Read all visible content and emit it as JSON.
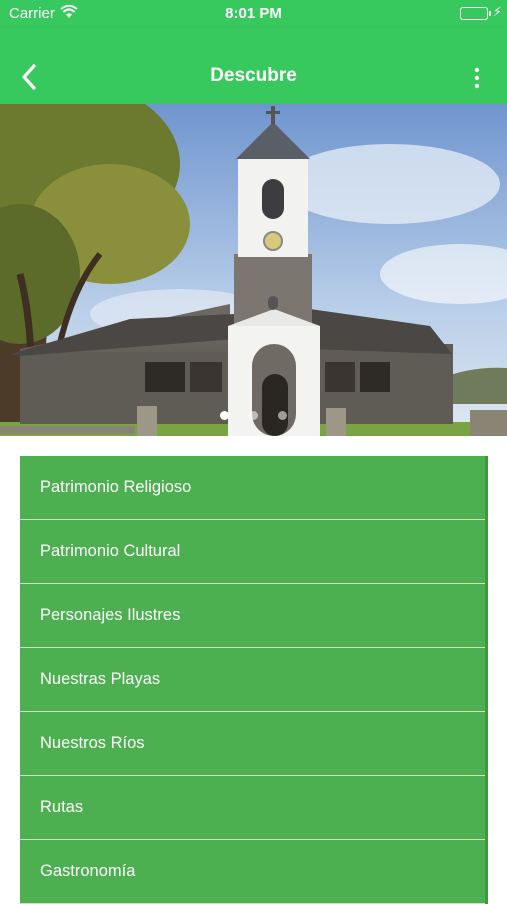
{
  "status_bar": {
    "carrier": "Carrier",
    "time": "8:01 PM"
  },
  "nav": {
    "title": "Descubre",
    "back_icon": "chevron-left-icon",
    "menu_icon": "more-vertical-icon"
  },
  "carousel": {
    "image": "church-photo",
    "page_count": 3,
    "active_index": 0
  },
  "menu": {
    "items": [
      {
        "label": "Patrimonio Religioso"
      },
      {
        "label": "Patrimonio Cultural"
      },
      {
        "label": "Personajes Ilustres"
      },
      {
        "label": "Nuestras Playas"
      },
      {
        "label": "Nuestros Ríos"
      },
      {
        "label": "Rutas"
      },
      {
        "label": "Gastronomía"
      }
    ]
  },
  "colors": {
    "header": "#37c85e",
    "menu_item": "#4caf50"
  }
}
